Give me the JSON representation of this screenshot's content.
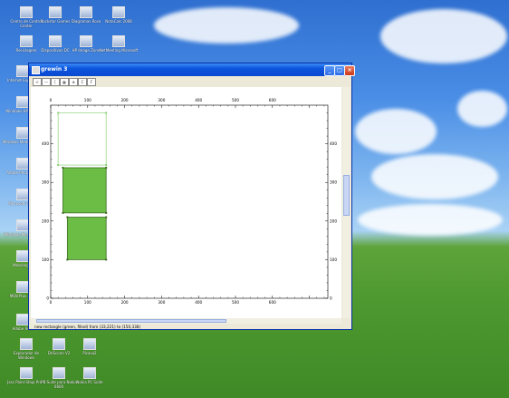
{
  "desktop": {
    "icons": [
      {
        "label": "Centro de Control Center",
        "x": 6,
        "y": 7
      },
      {
        "label": "Rockstar Games",
        "x": 38,
        "y": 7
      },
      {
        "label": "Diagramas Rosa",
        "x": 72,
        "y": 7
      },
      {
        "label": "NotaCalc 2008",
        "x": 108,
        "y": 7
      },
      {
        "label": "Reciclagem",
        "x": 6,
        "y": 39
      },
      {
        "label": "Dispositivos DC",
        "x": 38,
        "y": 39
      },
      {
        "label": "HP Image Zone",
        "x": 72,
        "y": 39
      },
      {
        "label": "NetMeeting Microsoft",
        "x": 108,
        "y": 39
      },
      {
        "label": "Internet Explorer",
        "x": 2,
        "y": 72
      },
      {
        "label": "Windows HP-Quick",
        "x": 2,
        "y": 106
      },
      {
        "label": "Windows Media Player",
        "x": 2,
        "y": 140
      },
      {
        "label": "Adobe PhotoShop",
        "x": 2,
        "y": 174
      },
      {
        "label": "Microsoft Office",
        "x": 2,
        "y": 208
      },
      {
        "label": "Windows Messenger",
        "x": 2,
        "y": 242
      },
      {
        "label": "Messenger",
        "x": 2,
        "y": 276
      },
      {
        "label": "MSN Plus 4.50",
        "x": 2,
        "y": 310
      },
      {
        "label": "Adobe Re 8",
        "x": 2,
        "y": 346
      },
      {
        "label": "Explorador de Windows",
        "x": 6,
        "y": 373
      },
      {
        "label": "DriScone V2",
        "x": 42,
        "y": 373
      },
      {
        "label": "Picasa2",
        "x": 76,
        "y": 373
      },
      {
        "label": "Jasc Paint Shop Pro 9",
        "x": 6,
        "y": 405
      },
      {
        "label": "PC Suite para Nokia 6600",
        "x": 42,
        "y": 405
      },
      {
        "label": "Nokia PC Suite",
        "x": 76,
        "y": 405
      }
    ]
  },
  "window": {
    "title": "grewin 3",
    "toolbar": [
      "<",
      "—",
      "[",
      "▦",
      "⊕",
      "C",
      "F"
    ],
    "status": "new rectangle (green, filled) from (33,221) to (150,338)"
  },
  "chart_data": {
    "type": "scatter",
    "title": "",
    "xlabel": "",
    "ylabel": "",
    "xlim": [
      0,
      750
    ],
    "ylim": [
      0,
      500
    ],
    "xticks": [
      0,
      100,
      200,
      300,
      400,
      500,
      600,
      700
    ],
    "yticks": [
      0,
      100,
      200,
      300,
      400
    ],
    "xtick_labels": [
      "0",
      "100",
      "200",
      "300",
      "400",
      "500",
      "600"
    ],
    "ytick_labels": [
      "0",
      "100",
      "200",
      "300",
      "400"
    ],
    "rectangles": [
      {
        "x0": 20,
        "y0": 345,
        "x1": 150,
        "y1": 480,
        "filled": false,
        "color": "#8fd07a"
      },
      {
        "x0": 33,
        "y0": 221,
        "x1": 150,
        "y1": 338,
        "filled": true,
        "color": "#6cbd45"
      },
      {
        "x0": 45,
        "y0": 100,
        "x1": 150,
        "y1": 210,
        "filled": true,
        "color": "#6cbd45"
      }
    ]
  }
}
